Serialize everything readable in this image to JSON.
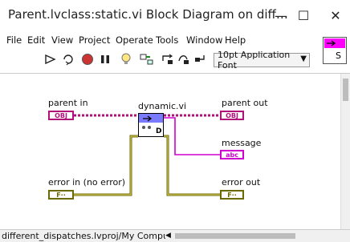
{
  "window": {
    "title": "Parent.lvclass:static.vi Block Diagram on diff…",
    "minimize": "—",
    "maximize": "☐",
    "close": "✕"
  },
  "menu": [
    "File",
    "Edit",
    "View",
    "Project",
    "Operate",
    "Tools",
    "Window",
    "Help"
  ],
  "toolbar": {
    "font_select": "10pt Application Font"
  },
  "connector_pane": {
    "letter": "S"
  },
  "diagram": {
    "controls": {
      "parent_in": "parent in",
      "error_in": "error in (no error)"
    },
    "indicators": {
      "parent_out": "parent out",
      "message": "message",
      "error_out": "error out"
    },
    "subvi": {
      "label": "dynamic.vi",
      "badge": "D"
    },
    "terminal_text": {
      "obj": "OBJ",
      "abc": "abc",
      "err": "F··"
    }
  },
  "status": {
    "project": "different_dispatches.lvproj/My Computer"
  },
  "colors": {
    "class_wire": "#b0127a",
    "string_wire": "#d000d0",
    "error_wire": "#6a6a00"
  }
}
